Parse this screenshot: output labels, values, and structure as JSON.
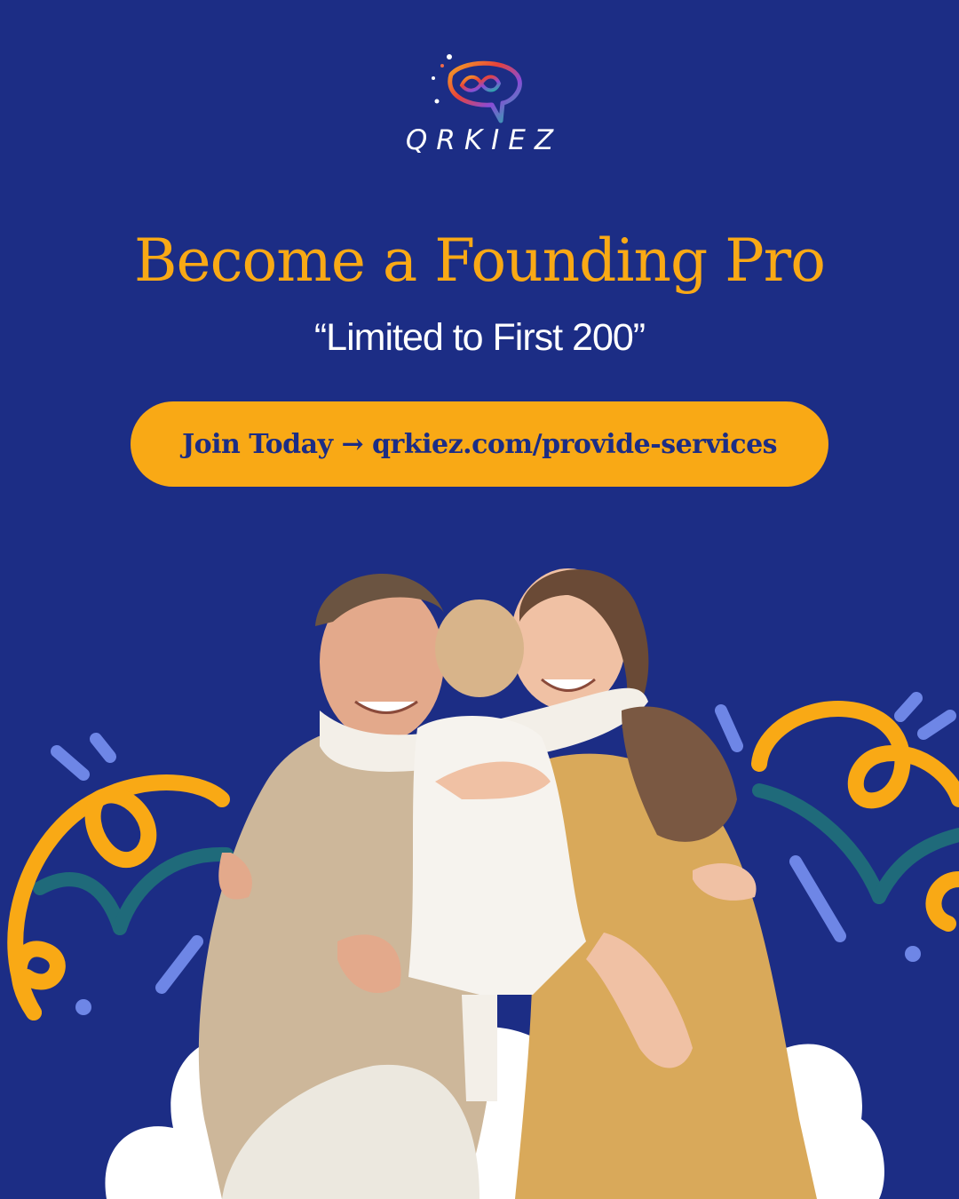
{
  "brand": {
    "name": "QRKIEZ"
  },
  "headline": "Become a Founding Pro",
  "subheadline": "“Limited to First 200”",
  "cta": {
    "label": "Join Today → qrkiez.com/provide-services"
  },
  "colors": {
    "background": "#1c2d85",
    "accent_orange": "#f9a915",
    "teal": "#1f6a7a",
    "periwinkle": "#6e86e6",
    "white": "#ffffff"
  },
  "photo": {
    "subject": "family-hug"
  }
}
